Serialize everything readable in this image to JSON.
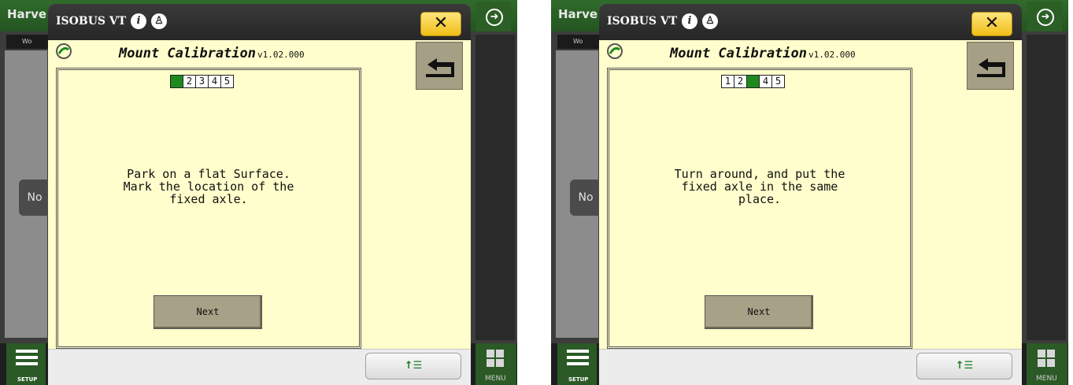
{
  "screens": [
    {
      "background": {
        "title": "Harve",
        "tab": "Wo",
        "side_label": "No",
        "setup_label": "SETUP",
        "menu_label": "MENU"
      },
      "modal": {
        "title": "ISOBUS VT",
        "close_label": "✕",
        "vt_title": "Mount Calibration",
        "vt_version": "v1.02.000",
        "steps": [
          "1",
          "2",
          "3",
          "4",
          "5"
        ],
        "active_step": 1,
        "instruction": "Park on a flat Surface.\nMark the location of the\nfixed axle.",
        "next_label": "Next",
        "list_button": "↑☰"
      }
    },
    {
      "background": {
        "title": "Harve",
        "tab": "Wo",
        "side_label": "No",
        "setup_label": "SETUP",
        "menu_label": "MENU"
      },
      "modal": {
        "title": "ISOBUS VT",
        "close_label": "✕",
        "vt_title": "Mount Calibration",
        "vt_version": "v1.02.000",
        "steps": [
          "1",
          "2",
          "3",
          "4",
          "5"
        ],
        "active_step": 3,
        "instruction": "Turn around, and put the\nfixed axle in the same\nplace.",
        "next_label": "Next",
        "list_button": "↑☰"
      }
    }
  ],
  "colors": {
    "accent_green": "#1e8a1e",
    "vt_background": "#fffecc",
    "close_yellow": "#f0be18"
  }
}
